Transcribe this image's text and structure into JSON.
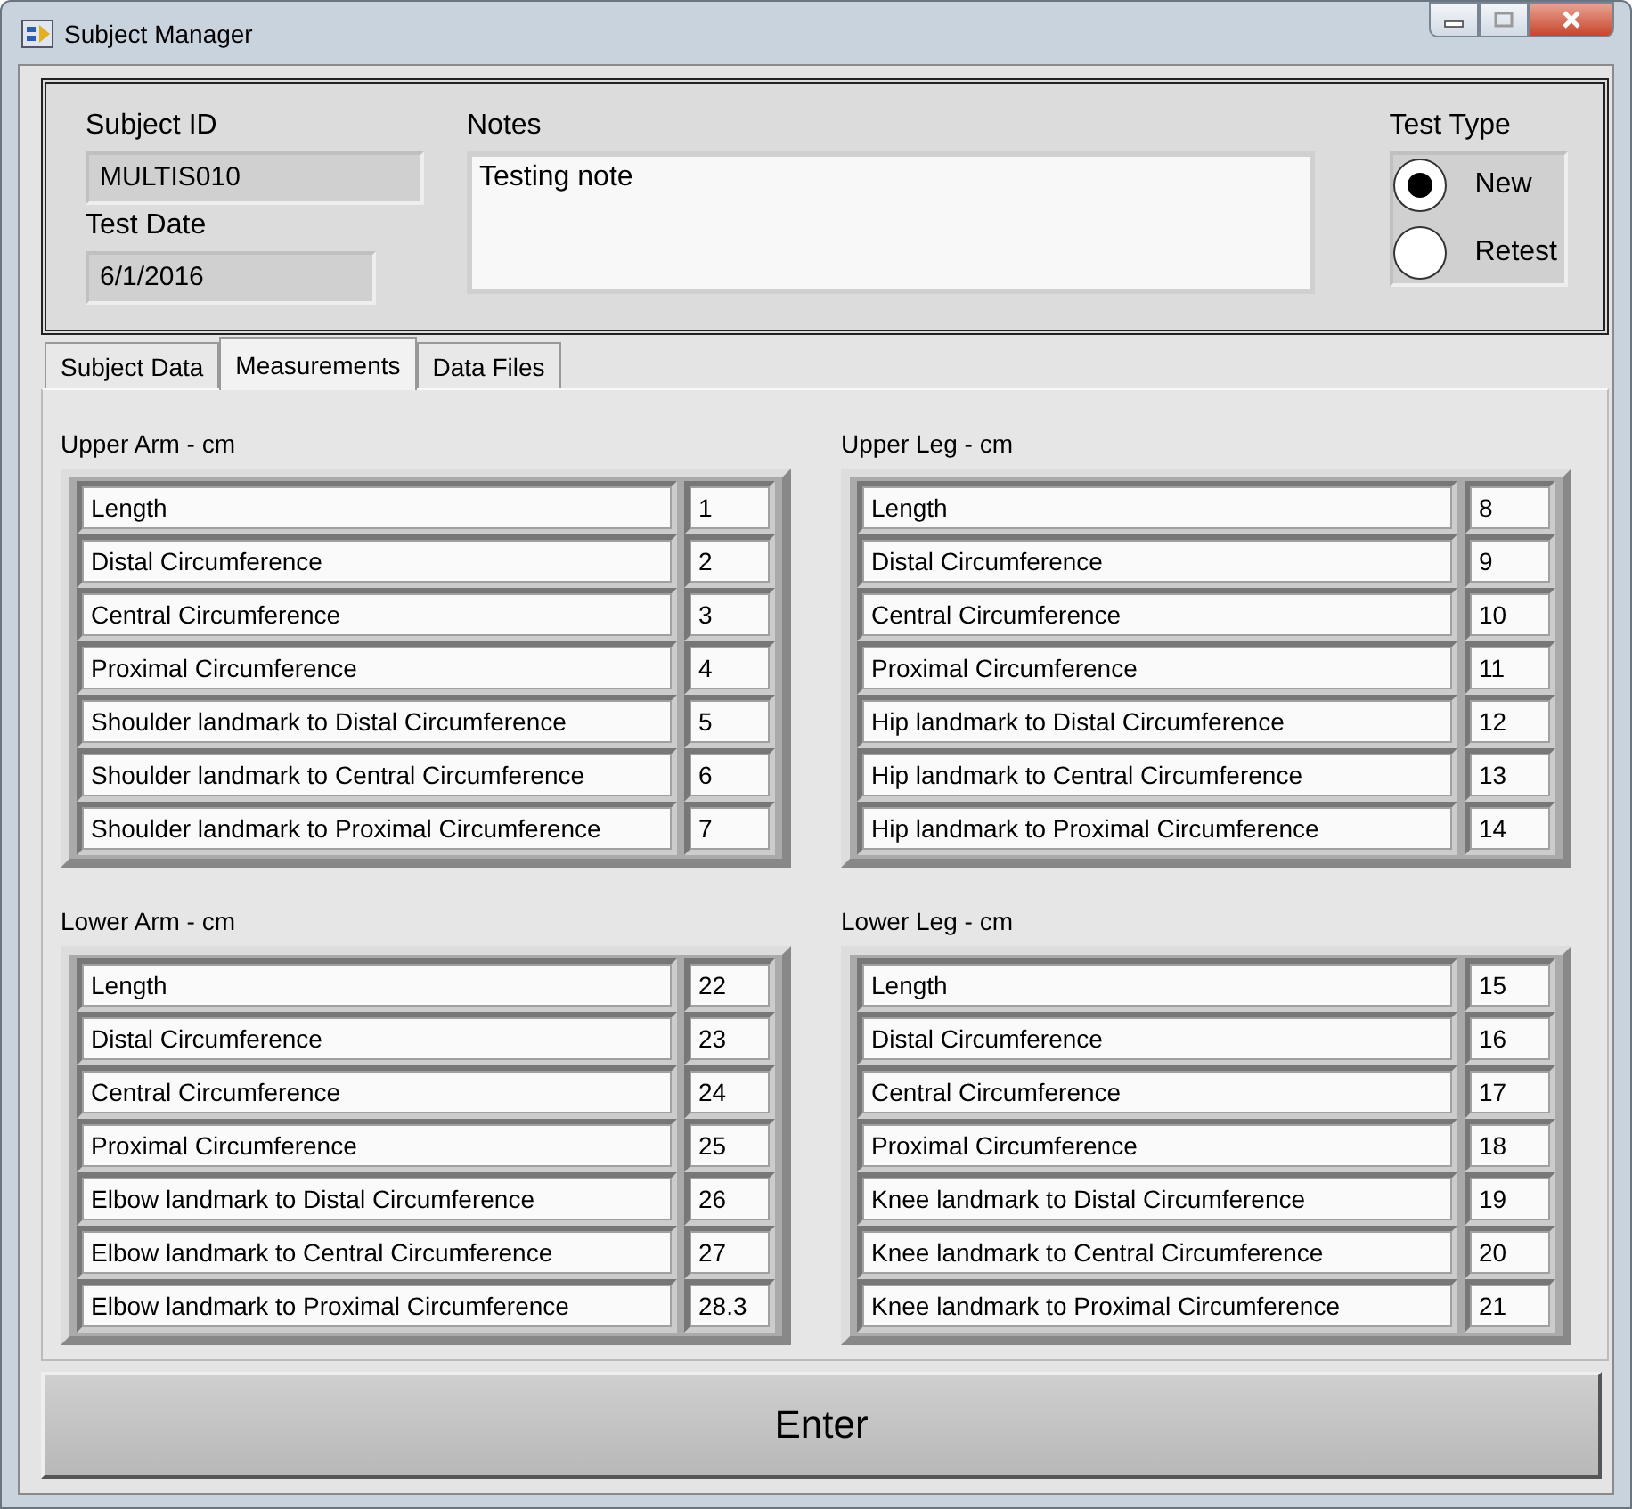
{
  "window": {
    "title": "Subject Manager"
  },
  "header": {
    "subject_id": {
      "label": "Subject ID",
      "value": "MULTIS010"
    },
    "test_date": {
      "label": "Test Date",
      "value": "6/1/2016"
    },
    "notes": {
      "label": "Notes",
      "value": "Testing note"
    },
    "test_type": {
      "label": "Test Type",
      "options": [
        {
          "label": "New",
          "selected": true
        },
        {
          "label": "Retest",
          "selected": false
        }
      ]
    }
  },
  "tabs": [
    {
      "label": "Subject Data",
      "selected": false
    },
    {
      "label": "Measurements",
      "selected": true
    },
    {
      "label": "Data Files",
      "selected": false
    }
  ],
  "groups": [
    {
      "title": "Upper Arm - cm",
      "rows": [
        {
          "label": "Length",
          "value": "1"
        },
        {
          "label": "Distal Circumference",
          "value": "2"
        },
        {
          "label": "Central Circumference",
          "value": "3"
        },
        {
          "label": "Proximal Circumference",
          "value": "4"
        },
        {
          "label": "Shoulder landmark to Distal Circumference",
          "value": "5"
        },
        {
          "label": "Shoulder landmark to Central Circumference",
          "value": "6"
        },
        {
          "label": "Shoulder landmark to Proximal Circumference",
          "value": "7"
        }
      ]
    },
    {
      "title": "Upper Leg - cm",
      "rows": [
        {
          "label": "Length",
          "value": "8"
        },
        {
          "label": "Distal Circumference",
          "value": "9"
        },
        {
          "label": "Central Circumference",
          "value": "10"
        },
        {
          "label": "Proximal Circumference",
          "value": "11"
        },
        {
          "label": "Hip landmark to Distal Circumference",
          "value": "12"
        },
        {
          "label": "Hip landmark to Central Circumference",
          "value": "13"
        },
        {
          "label": "Hip landmark to Proximal Circumference",
          "value": "14"
        }
      ]
    },
    {
      "title": "Lower Arm - cm",
      "rows": [
        {
          "label": "Length",
          "value": "22"
        },
        {
          "label": "Distal Circumference",
          "value": "23"
        },
        {
          "label": "Central Circumference",
          "value": "24"
        },
        {
          "label": "Proximal Circumference",
          "value": "25"
        },
        {
          "label": "Elbow landmark to Distal Circumference",
          "value": "26"
        },
        {
          "label": "Elbow landmark to Central Circumference",
          "value": "27"
        },
        {
          "label": "Elbow landmark to Proximal Circumference",
          "value": "28.3"
        }
      ]
    },
    {
      "title": "Lower Leg - cm",
      "rows": [
        {
          "label": "Length",
          "value": "15"
        },
        {
          "label": "Distal Circumference",
          "value": "16"
        },
        {
          "label": "Central Circumference",
          "value": "17"
        },
        {
          "label": "Proximal Circumference",
          "value": "18"
        },
        {
          "label": "Knee landmark to Distal Circumference",
          "value": "19"
        },
        {
          "label": "Knee landmark to Central Circumference",
          "value": "20"
        },
        {
          "label": "Knee landmark to Proximal Circumference",
          "value": "21"
        }
      ]
    }
  ],
  "enter_button": {
    "label": "Enter"
  }
}
